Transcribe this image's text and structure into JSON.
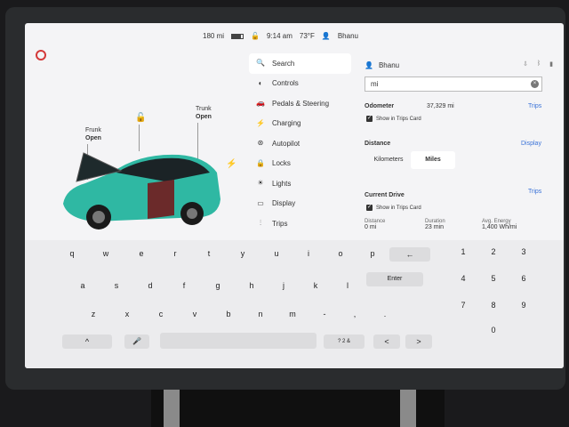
{
  "status_bar": {
    "range": "180 mi",
    "battery_level": 0.8,
    "time": "9:14 am",
    "temperature": "73°F",
    "driver": "Bhanu"
  },
  "car": {
    "frunk_label": "Frunk",
    "frunk_state": "Open",
    "trunk_label": "Trunk",
    "trunk_state": "Open",
    "body_color": "#2fb8a3"
  },
  "nav": {
    "items": [
      {
        "label": "Search",
        "icon": "search-icon"
      },
      {
        "label": "Controls",
        "icon": "toggle-icon"
      },
      {
        "label": "Pedals & Steering",
        "icon": "car-icon"
      },
      {
        "label": "Charging",
        "icon": "bolt-icon"
      },
      {
        "label": "Autopilot",
        "icon": "steering-wheel-icon"
      },
      {
        "label": "Locks",
        "icon": "lock-icon"
      },
      {
        "label": "Lights",
        "icon": "sun-icon"
      },
      {
        "label": "Display",
        "icon": "display-icon"
      },
      {
        "label": "Trips",
        "icon": "trips-icon"
      }
    ]
  },
  "panel": {
    "user_name": "Bhanu",
    "search_value": "mi",
    "odometer_label": "Odometer",
    "odometer_value": "37,329 mi",
    "odometer_link": "Trips",
    "odometer_checkbox": "Show in Trips Card",
    "distance_label": "Distance",
    "distance_link": "Display",
    "distance_options": [
      "Kilometers",
      "Miles"
    ],
    "distance_selected": "Miles",
    "current_drive_label": "Current Drive",
    "current_drive_link": "Trips",
    "current_drive_checkbox": "Show in Trips Card",
    "stats": [
      {
        "label": "Distance",
        "value": "0 mi"
      },
      {
        "label": "Duration",
        "value": "23 min"
      },
      {
        "label": "Avg. Energy",
        "value": "1,400 Wh/mi"
      }
    ]
  },
  "keyboard": {
    "row1": [
      "q",
      "w",
      "e",
      "r",
      "t",
      "y",
      "u",
      "i",
      "o",
      "p"
    ],
    "row2": [
      "a",
      "s",
      "d",
      "f",
      "g",
      "h",
      "j",
      "k",
      "l"
    ],
    "row3": [
      "z",
      "x",
      "c",
      "v",
      "b",
      "n",
      "m",
      "-",
      ",",
      "."
    ],
    "backspace": "←",
    "enter": "Enter",
    "shift": "^",
    "mic": "🎤",
    "symbols": "? 2 &",
    "left": "<",
    "right": ">",
    "numpad": [
      "1",
      "2",
      "3",
      "4",
      "5",
      "6",
      "7",
      "8",
      "9",
      "0"
    ]
  }
}
